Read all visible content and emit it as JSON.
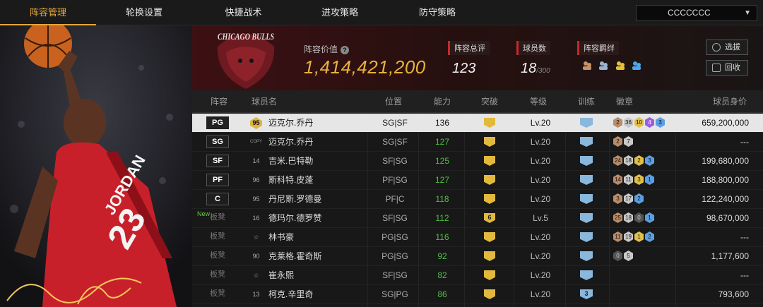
{
  "nav": {
    "tabs": [
      "阵容管理",
      "轮换设置",
      "快捷战术",
      "进攻策略",
      "防守策略"
    ],
    "active_index": 0,
    "account_dropdown": "CCCCCCC"
  },
  "header": {
    "team_logo_text": "CHICAGO BULLS",
    "lineup_value_label": "阵容价值",
    "lineup_value": "1,414,421,200",
    "overall_label": "阵容总评",
    "overall_value": "123",
    "player_count_label": "球员数",
    "player_count": "18",
    "player_capacity": "/300",
    "synergy_label": "阵容羁绊",
    "scout_button": "选拔",
    "recycle_button": "回收"
  },
  "player_art": {
    "jersey_text": "JORDAN",
    "jersey_number": "23",
    "signature": "Signature"
  },
  "table": {
    "headers": [
      "阵容",
      "球员名",
      "位置",
      "能力",
      "突破",
      "等级",
      "训练",
      "徽章",
      "球员身价"
    ],
    "rows": [
      {
        "slot": "PG",
        "new": "",
        "num": "95",
        "name": "迈克尔.乔丹",
        "pos": "SG|SF",
        "rating": "136",
        "break": "",
        "level": "Lv.20",
        "train": "",
        "badges": [
          [
            "bz",
            "2"
          ],
          [
            "sv",
            "36"
          ],
          [
            "gd",
            "10"
          ],
          [
            "pp",
            "4"
          ],
          [
            "bl",
            "3"
          ]
        ],
        "worth": "659,200,000"
      },
      {
        "slot": "SG",
        "new": "",
        "num": "COPY",
        "name": "迈克尔.乔丹",
        "pos": "SG|SF",
        "rating": "127",
        "break": "",
        "level": "Lv.20",
        "train": "",
        "badges": [
          [
            "bz",
            "2"
          ],
          [
            "sv",
            "7"
          ]
        ],
        "worth": "---"
      },
      {
        "slot": "SF",
        "new": "",
        "num": "14",
        "name": "吉米.巴特勒",
        "pos": "SF|SG",
        "rating": "125",
        "break": "",
        "level": "Lv.20",
        "train": "",
        "badges": [
          [
            "bz",
            "24"
          ],
          [
            "sv",
            "18"
          ],
          [
            "gd",
            "2"
          ],
          [
            "bl",
            "3"
          ]
        ],
        "worth": "199,680,000"
      },
      {
        "slot": "PF",
        "new": "",
        "num": "96",
        "name": "斯科特.皮蓬",
        "pos": "PF|SG",
        "rating": "127",
        "break": "",
        "level": "Lv.20",
        "train": "",
        "badges": [
          [
            "bz",
            "14"
          ],
          [
            "sv",
            "11"
          ],
          [
            "gd",
            "3"
          ],
          [
            "bl",
            "1"
          ]
        ],
        "worth": "188,800,000"
      },
      {
        "slot": "C",
        "new": "",
        "num": "95",
        "name": "丹尼斯.罗德曼",
        "pos": "PF|C",
        "rating": "118",
        "break": "",
        "level": "Lv.20",
        "train": "",
        "badges": [
          [
            "bz",
            "3"
          ],
          [
            "sv",
            "17"
          ],
          [
            "bl",
            "2"
          ]
        ],
        "worth": "122,240,000"
      },
      {
        "slot": "板凳",
        "new": "New",
        "num": "16",
        "name": "德玛尔.德罗赞",
        "pos": "SF|SG",
        "rating": "112",
        "break": "6",
        "level": "Lv.5",
        "train": "",
        "badges": [
          [
            "bz",
            "25"
          ],
          [
            "sv",
            "18"
          ],
          [
            "dk",
            "0"
          ],
          [
            "bl",
            "1"
          ]
        ],
        "worth": "98,670,000"
      },
      {
        "slot": "板凳",
        "new": "",
        "num": "☆",
        "name": "林书豪",
        "pos": "PG|SG",
        "rating": "116",
        "break": "",
        "level": "Lv.20",
        "train": "",
        "badges": [
          [
            "bz",
            "11"
          ],
          [
            "sv",
            "19"
          ],
          [
            "gd",
            "1"
          ],
          [
            "bl",
            "2"
          ]
        ],
        "worth": "---"
      },
      {
        "slot": "板凳",
        "new": "",
        "num": "90",
        "name": "克莱格.霍奇斯",
        "pos": "PG|SG",
        "rating": "92",
        "break": "",
        "level": "Lv.20",
        "train": "",
        "badges": [
          [
            "dk",
            "0"
          ],
          [
            "sv",
            "5"
          ]
        ],
        "worth": "1,177,600"
      },
      {
        "slot": "板凳",
        "new": "",
        "num": "☆",
        "name": "崔永熙",
        "pos": "SF|SG",
        "rating": "82",
        "break": "",
        "level": "Lv.20",
        "train": "",
        "badges": [],
        "worth": "---"
      },
      {
        "slot": "板凳",
        "new": "",
        "num": "13",
        "name": "柯克.辛里奇",
        "pos": "SG|PG",
        "rating": "86",
        "break": "",
        "level": "Lv.20",
        "train": "3",
        "badges": [],
        "worth": "793,600"
      }
    ]
  }
}
